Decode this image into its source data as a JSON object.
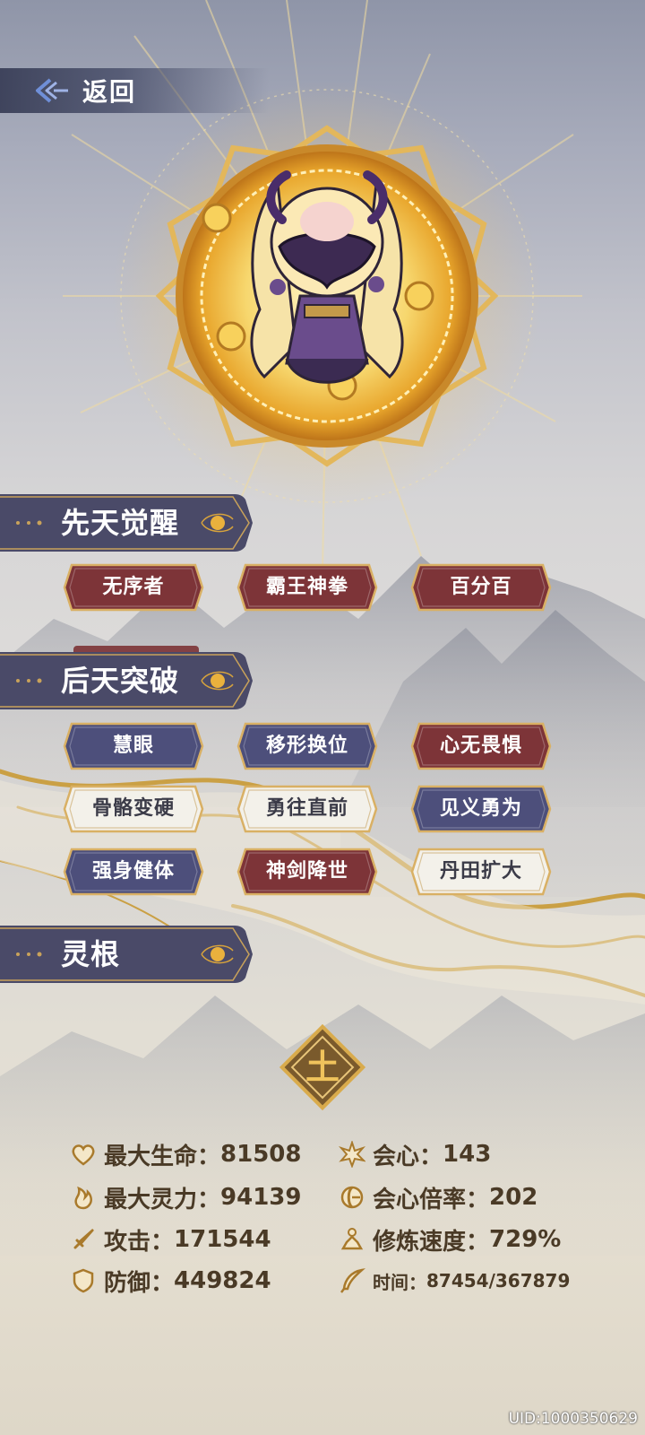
{
  "header": {
    "back_label": "返回"
  },
  "colors": {
    "tag_red": "#7d3438",
    "tag_purple": "#4d4f7b",
    "tag_white": "#f3f1ea",
    "gold": "#d7a33c",
    "banner": "#4a4a68",
    "stat_text": "#4a3a26"
  },
  "sections": {
    "innate": {
      "title": "先天觉醒",
      "tags": [
        {
          "label": "无序者",
          "style": "red"
        },
        {
          "label": "霸王神拳",
          "style": "red"
        },
        {
          "label": "百分百",
          "style": "red"
        }
      ]
    },
    "acquired": {
      "title": "后天突破",
      "tags": [
        {
          "label": "慧眼",
          "style": "purple"
        },
        {
          "label": "移形换位",
          "style": "purple"
        },
        {
          "label": "心无畏惧",
          "style": "red"
        },
        {
          "label": "骨骼变硬",
          "style": "white"
        },
        {
          "label": "勇往直前",
          "style": "white"
        },
        {
          "label": "见义勇为",
          "style": "purple"
        },
        {
          "label": "强身健体",
          "style": "purple"
        },
        {
          "label": "神剑降世",
          "style": "red"
        },
        {
          "label": "丹田扩大",
          "style": "white"
        }
      ]
    },
    "spirit_root": {
      "title": "灵根",
      "emblem_char": "土"
    }
  },
  "stats": {
    "max_hp": {
      "label": "最大生命：",
      "value": "81508",
      "icon": "heart-icon"
    },
    "max_spirit": {
      "label": "最大灵力：",
      "value": "94139",
      "icon": "flame-icon"
    },
    "attack": {
      "label": "攻击：",
      "value": "171544",
      "icon": "sword-icon"
    },
    "defense": {
      "label": "防御：",
      "value": "449824",
      "icon": "shield-icon"
    },
    "crit": {
      "label": "会心：",
      "value": "143",
      "icon": "burst-icon"
    },
    "crit_rate": {
      "label": "会心倍率：",
      "value": "202",
      "icon": "crescent-icon"
    },
    "cultivation_speed": {
      "label": "修炼速度：",
      "value": "729%",
      "icon": "meditation-icon"
    },
    "time": {
      "label": "时间：",
      "value": "87454/367879",
      "icon": "feather-icon"
    }
  },
  "footer": {
    "uid": "UID:1000350629"
  }
}
